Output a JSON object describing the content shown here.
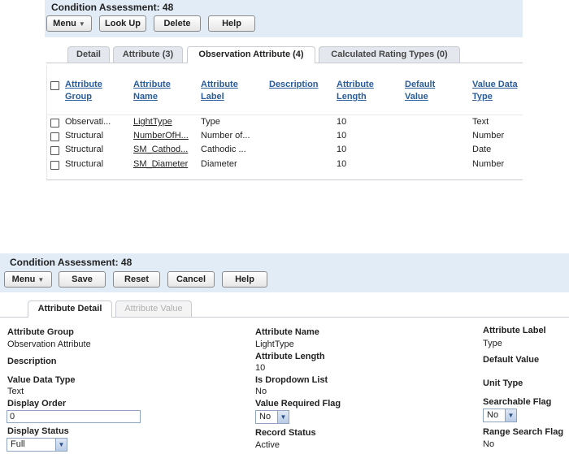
{
  "list_view": {
    "title": "Condition Assessment: 48",
    "toolbar": {
      "menu": "Menu",
      "look_up": "Look Up",
      "delete": "Delete",
      "help": "Help"
    },
    "tabs": [
      "Detail",
      "Attribute (3)",
      "Observation Attribute (4)",
      "Calculated Rating Types (0)"
    ],
    "active_tab": "Observation Attribute (4)",
    "columns": [
      [
        "Attribute",
        "Group"
      ],
      [
        "Attribute",
        "Name"
      ],
      [
        "Attribute",
        "Label"
      ],
      [
        "Description",
        ""
      ],
      [
        "Attribute",
        "Length"
      ],
      [
        "Default",
        "Value"
      ],
      [
        "Value Data",
        "Type"
      ]
    ],
    "rows": [
      {
        "group": "Observati...",
        "name": "LightType",
        "label": "Type",
        "length": "10",
        "data_type": "Text"
      },
      {
        "group": "Structural",
        "name": "NumberOfH...",
        "label": "Number of...",
        "length": "10",
        "data_type": "Number"
      },
      {
        "group": "Structural",
        "name": "SM_Cathod...",
        "label": "Cathodic ...",
        "length": "10",
        "data_type": "Date"
      },
      {
        "group": "Structural",
        "name": "SM_Diameter",
        "label": "Diameter",
        "length": "10",
        "data_type": "Number"
      }
    ]
  },
  "detail_view": {
    "title": "Condition Assessment: 48",
    "toolbar": {
      "menu": "Menu",
      "save": "Save",
      "reset": "Reset",
      "cancel": "Cancel",
      "help": "Help"
    },
    "tabs": [
      "Attribute Detail",
      "Attribute Value"
    ],
    "active_tab": "Attribute Detail",
    "fields": {
      "attribute_group": {
        "label": "Attribute Group",
        "value": "Observation Attribute"
      },
      "description": {
        "label": "Description"
      },
      "value_data_type": {
        "label": "Value Data Type",
        "value": "Text"
      },
      "display_order": {
        "label": "Display Order",
        "value": "0"
      },
      "display_status": {
        "label": "Display Status",
        "value": "Full"
      },
      "attribute_name": {
        "label": "Attribute Name",
        "value": "LightType"
      },
      "attribute_length": {
        "label": "Attribute Length",
        "value": "10"
      },
      "is_dropdown_list": {
        "label": "Is Dropdown List",
        "value": "No"
      },
      "value_required_flag": {
        "label": "Value Required Flag",
        "value": "No"
      },
      "record_status": {
        "label": "Record Status",
        "value": "Active"
      },
      "attribute_label": {
        "label": "Attribute Label",
        "value": "Type"
      },
      "default_value": {
        "label": "Default Value"
      },
      "unit_type": {
        "label": "Unit Type"
      },
      "searchable_flag": {
        "label": "Searchable Flag",
        "value": "No"
      },
      "range_search_flag": {
        "label": "Range Search Flag",
        "value": "No"
      }
    }
  },
  "colors": {
    "header_bg": "#e2ecf7",
    "link": "#2a5c9a",
    "tab_bg": "#e4e8ee"
  }
}
